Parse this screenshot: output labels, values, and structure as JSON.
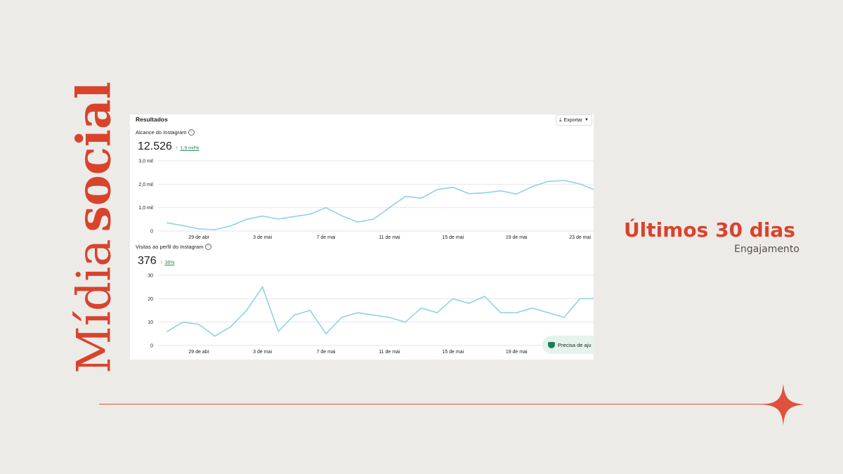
{
  "slide": {
    "vertical_title_a": "Mídia",
    "vertical_title_b": "social",
    "side_title": "Últimos 30 dias",
    "side_subtitle": "Engajamento",
    "accent_color": "#d9432c"
  },
  "panel": {
    "title": "Resultados",
    "export_label": "Exportar",
    "help_label": "Precisa de aju"
  },
  "reach": {
    "label": "Alcance do Instagram",
    "value": "12.526",
    "change": "1,9 mil%"
  },
  "visits": {
    "label": "Visitas ao perfil do Instagram",
    "value": "376",
    "change": "36%"
  },
  "chart_data": [
    {
      "type": "line",
      "title": "Alcance do Instagram",
      "x_ticks": [
        "29 de abr",
        "3 de mai",
        "7 de mai",
        "11 de mai",
        "15 de mai",
        "19 de mai",
        "23 de mai"
      ],
      "x_tick_index": [
        2,
        6,
        10,
        14,
        18,
        22,
        26
      ],
      "y_ticks": [
        "0",
        "1,0 mil",
        "2,0 mil",
        "3,0 mil"
      ],
      "ylim": [
        0,
        3000
      ],
      "grid": true,
      "line_color": "#8fd1ec",
      "series": [
        {
          "values": [
            350,
            230,
            90,
            60,
            220,
            500,
            640,
            510,
            620,
            720,
            1000,
            650,
            380,
            510,
            1000,
            1480,
            1400,
            1770,
            1870,
            1600,
            1630,
            1720,
            1580,
            1900,
            2120,
            2160,
            2010,
            1740
          ]
        }
      ]
    },
    {
      "type": "line",
      "title": "Visitas ao perfil do Instagram",
      "x_ticks": [
        "29 de abr",
        "3 de mai",
        "7 de mai",
        "11 de mai",
        "15 de mai",
        "19 de mai"
      ],
      "x_tick_index": [
        2,
        6,
        10,
        14,
        18,
        22
      ],
      "y_ticks": [
        "0",
        "10",
        "20",
        "30"
      ],
      "ylim": [
        0,
        30
      ],
      "grid": true,
      "line_color": "#8fd1ec",
      "series": [
        {
          "values": [
            6,
            10,
            9,
            4,
            8,
            15,
            25,
            6,
            13,
            15,
            5,
            12,
            14,
            13,
            12,
            10,
            16,
            14,
            20,
            18,
            21,
            14,
            14,
            16,
            14,
            12,
            20,
            20
          ]
        }
      ]
    }
  ]
}
